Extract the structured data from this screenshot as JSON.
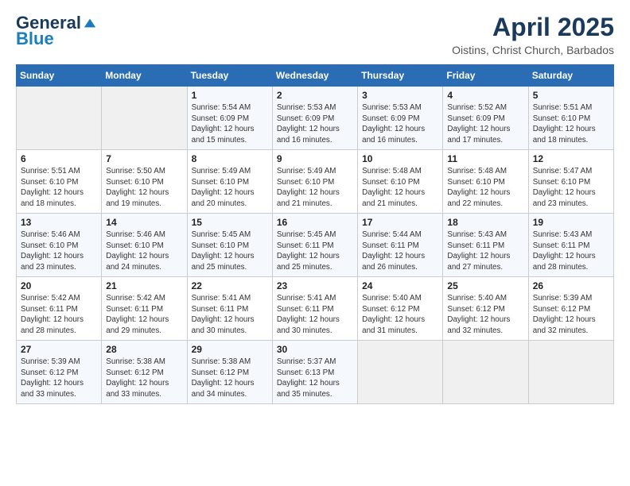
{
  "logo": {
    "general": "General",
    "blue": "Blue"
  },
  "header": {
    "month": "April 2025",
    "location": "Oistins, Christ Church, Barbados"
  },
  "days_of_week": [
    "Sunday",
    "Monday",
    "Tuesday",
    "Wednesday",
    "Thursday",
    "Friday",
    "Saturday"
  ],
  "weeks": [
    [
      {
        "day": "",
        "sunrise": "",
        "sunset": "",
        "daylight": ""
      },
      {
        "day": "",
        "sunrise": "",
        "sunset": "",
        "daylight": ""
      },
      {
        "day": "1",
        "sunrise": "Sunrise: 5:54 AM",
        "sunset": "Sunset: 6:09 PM",
        "daylight": "Daylight: 12 hours and 15 minutes."
      },
      {
        "day": "2",
        "sunrise": "Sunrise: 5:53 AM",
        "sunset": "Sunset: 6:09 PM",
        "daylight": "Daylight: 12 hours and 16 minutes."
      },
      {
        "day": "3",
        "sunrise": "Sunrise: 5:53 AM",
        "sunset": "Sunset: 6:09 PM",
        "daylight": "Daylight: 12 hours and 16 minutes."
      },
      {
        "day": "4",
        "sunrise": "Sunrise: 5:52 AM",
        "sunset": "Sunset: 6:09 PM",
        "daylight": "Daylight: 12 hours and 17 minutes."
      },
      {
        "day": "5",
        "sunrise": "Sunrise: 5:51 AM",
        "sunset": "Sunset: 6:10 PM",
        "daylight": "Daylight: 12 hours and 18 minutes."
      }
    ],
    [
      {
        "day": "6",
        "sunrise": "Sunrise: 5:51 AM",
        "sunset": "Sunset: 6:10 PM",
        "daylight": "Daylight: 12 hours and 18 minutes."
      },
      {
        "day": "7",
        "sunrise": "Sunrise: 5:50 AM",
        "sunset": "Sunset: 6:10 PM",
        "daylight": "Daylight: 12 hours and 19 minutes."
      },
      {
        "day": "8",
        "sunrise": "Sunrise: 5:49 AM",
        "sunset": "Sunset: 6:10 PM",
        "daylight": "Daylight: 12 hours and 20 minutes."
      },
      {
        "day": "9",
        "sunrise": "Sunrise: 5:49 AM",
        "sunset": "Sunset: 6:10 PM",
        "daylight": "Daylight: 12 hours and 21 minutes."
      },
      {
        "day": "10",
        "sunrise": "Sunrise: 5:48 AM",
        "sunset": "Sunset: 6:10 PM",
        "daylight": "Daylight: 12 hours and 21 minutes."
      },
      {
        "day": "11",
        "sunrise": "Sunrise: 5:48 AM",
        "sunset": "Sunset: 6:10 PM",
        "daylight": "Daylight: 12 hours and 22 minutes."
      },
      {
        "day": "12",
        "sunrise": "Sunrise: 5:47 AM",
        "sunset": "Sunset: 6:10 PM",
        "daylight": "Daylight: 12 hours and 23 minutes."
      }
    ],
    [
      {
        "day": "13",
        "sunrise": "Sunrise: 5:46 AM",
        "sunset": "Sunset: 6:10 PM",
        "daylight": "Daylight: 12 hours and 23 minutes."
      },
      {
        "day": "14",
        "sunrise": "Sunrise: 5:46 AM",
        "sunset": "Sunset: 6:10 PM",
        "daylight": "Daylight: 12 hours and 24 minutes."
      },
      {
        "day": "15",
        "sunrise": "Sunrise: 5:45 AM",
        "sunset": "Sunset: 6:10 PM",
        "daylight": "Daylight: 12 hours and 25 minutes."
      },
      {
        "day": "16",
        "sunrise": "Sunrise: 5:45 AM",
        "sunset": "Sunset: 6:11 PM",
        "daylight": "Daylight: 12 hours and 25 minutes."
      },
      {
        "day": "17",
        "sunrise": "Sunrise: 5:44 AM",
        "sunset": "Sunset: 6:11 PM",
        "daylight": "Daylight: 12 hours and 26 minutes."
      },
      {
        "day": "18",
        "sunrise": "Sunrise: 5:43 AM",
        "sunset": "Sunset: 6:11 PM",
        "daylight": "Daylight: 12 hours and 27 minutes."
      },
      {
        "day": "19",
        "sunrise": "Sunrise: 5:43 AM",
        "sunset": "Sunset: 6:11 PM",
        "daylight": "Daylight: 12 hours and 28 minutes."
      }
    ],
    [
      {
        "day": "20",
        "sunrise": "Sunrise: 5:42 AM",
        "sunset": "Sunset: 6:11 PM",
        "daylight": "Daylight: 12 hours and 28 minutes."
      },
      {
        "day": "21",
        "sunrise": "Sunrise: 5:42 AM",
        "sunset": "Sunset: 6:11 PM",
        "daylight": "Daylight: 12 hours and 29 minutes."
      },
      {
        "day": "22",
        "sunrise": "Sunrise: 5:41 AM",
        "sunset": "Sunset: 6:11 PM",
        "daylight": "Daylight: 12 hours and 30 minutes."
      },
      {
        "day": "23",
        "sunrise": "Sunrise: 5:41 AM",
        "sunset": "Sunset: 6:11 PM",
        "daylight": "Daylight: 12 hours and 30 minutes."
      },
      {
        "day": "24",
        "sunrise": "Sunrise: 5:40 AM",
        "sunset": "Sunset: 6:12 PM",
        "daylight": "Daylight: 12 hours and 31 minutes."
      },
      {
        "day": "25",
        "sunrise": "Sunrise: 5:40 AM",
        "sunset": "Sunset: 6:12 PM",
        "daylight": "Daylight: 12 hours and 32 minutes."
      },
      {
        "day": "26",
        "sunrise": "Sunrise: 5:39 AM",
        "sunset": "Sunset: 6:12 PM",
        "daylight": "Daylight: 12 hours and 32 minutes."
      }
    ],
    [
      {
        "day": "27",
        "sunrise": "Sunrise: 5:39 AM",
        "sunset": "Sunset: 6:12 PM",
        "daylight": "Daylight: 12 hours and 33 minutes."
      },
      {
        "day": "28",
        "sunrise": "Sunrise: 5:38 AM",
        "sunset": "Sunset: 6:12 PM",
        "daylight": "Daylight: 12 hours and 33 minutes."
      },
      {
        "day": "29",
        "sunrise": "Sunrise: 5:38 AM",
        "sunset": "Sunset: 6:12 PM",
        "daylight": "Daylight: 12 hours and 34 minutes."
      },
      {
        "day": "30",
        "sunrise": "Sunrise: 5:37 AM",
        "sunset": "Sunset: 6:13 PM",
        "daylight": "Daylight: 12 hours and 35 minutes."
      },
      {
        "day": "",
        "sunrise": "",
        "sunset": "",
        "daylight": ""
      },
      {
        "day": "",
        "sunrise": "",
        "sunset": "",
        "daylight": ""
      },
      {
        "day": "",
        "sunrise": "",
        "sunset": "",
        "daylight": ""
      }
    ]
  ]
}
